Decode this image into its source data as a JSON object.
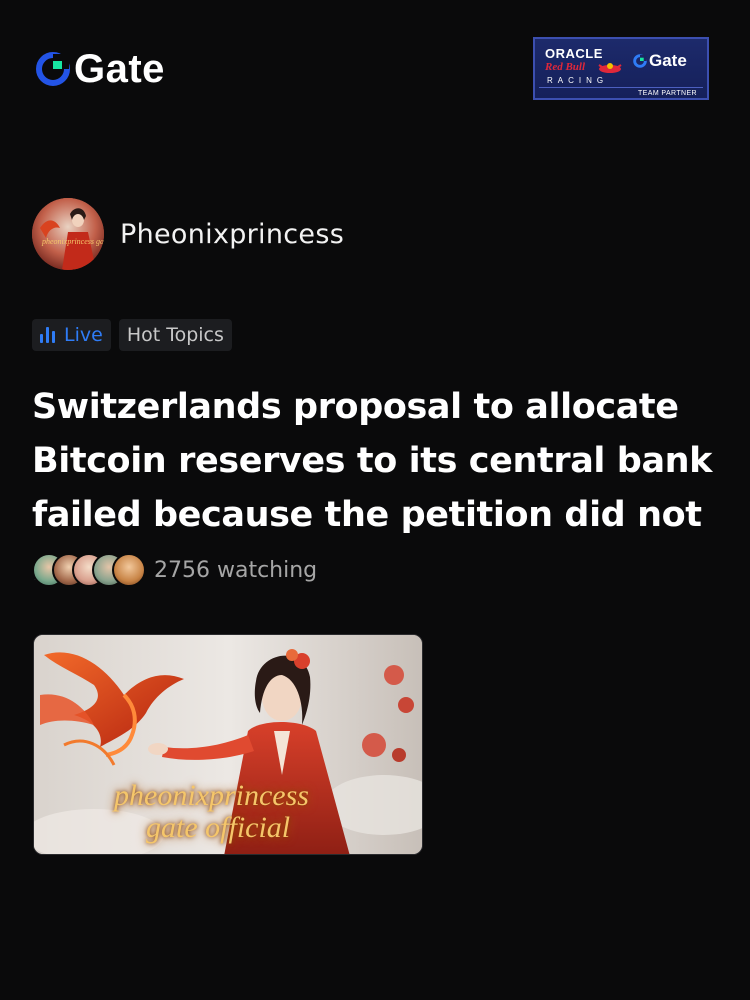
{
  "header": {
    "logo_text": "Gate",
    "partner": {
      "oracle": "ORACLE",
      "redbull": "Red Bull",
      "racing": "RACING",
      "gate": "Gate",
      "team_partner": "TEAM PARTNER"
    }
  },
  "author": {
    "name": "Pheonixprincess",
    "avatar_overlay": "pheonixprincess gate official"
  },
  "tags": [
    {
      "label": "Live",
      "icon": "live-bars-icon",
      "color": "#2f7cf6"
    },
    {
      "label": "Hot Topics"
    }
  ],
  "post": {
    "title": "Switzerlands proposal to allocate\nBitcoin reserves to its central bank\nfailed because the petition did not r..."
  },
  "watching": {
    "count_text": "2756 watching"
  },
  "preview": {
    "line1": "pheonixprincess",
    "line2": "gate official"
  },
  "colors": {
    "background": "#0a0a0b",
    "accent_blue": "#2f7cf6",
    "logo_green": "#17e6a1",
    "logo_blue": "#2354e6"
  }
}
